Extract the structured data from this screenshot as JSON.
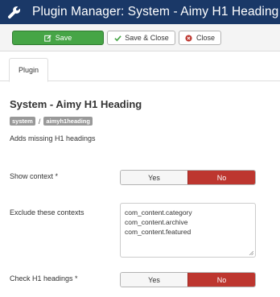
{
  "header": {
    "title": "Plugin Manager: System - Aimy H1 Heading",
    "icon": "wrench-icon"
  },
  "toolbar": {
    "save_label": "Save",
    "save_close_label": "Save & Close",
    "close_label": "Close"
  },
  "tabs": [
    {
      "label": "Plugin"
    }
  ],
  "plugin": {
    "title": "System - Aimy H1 Heading",
    "badges": {
      "group": "system",
      "separator": "/",
      "element": "aimyh1heading"
    },
    "description": "Adds missing H1 headings"
  },
  "fields": {
    "show_context": {
      "label": "Show context *",
      "yes": "Yes",
      "no": "No",
      "selected": "No"
    },
    "exclude_contexts": {
      "label": "Exclude these contexts",
      "lines": [
        "com_content.category",
        "com_content.archive",
        "com_content.featured"
      ]
    },
    "check_h1": {
      "label": "Check H1 headings *",
      "yes": "Yes",
      "no": "No",
      "selected": "No"
    }
  },
  "colors": {
    "header_bg": "#1a3867",
    "save_green": "#46a546",
    "no_red": "#bd362f"
  }
}
